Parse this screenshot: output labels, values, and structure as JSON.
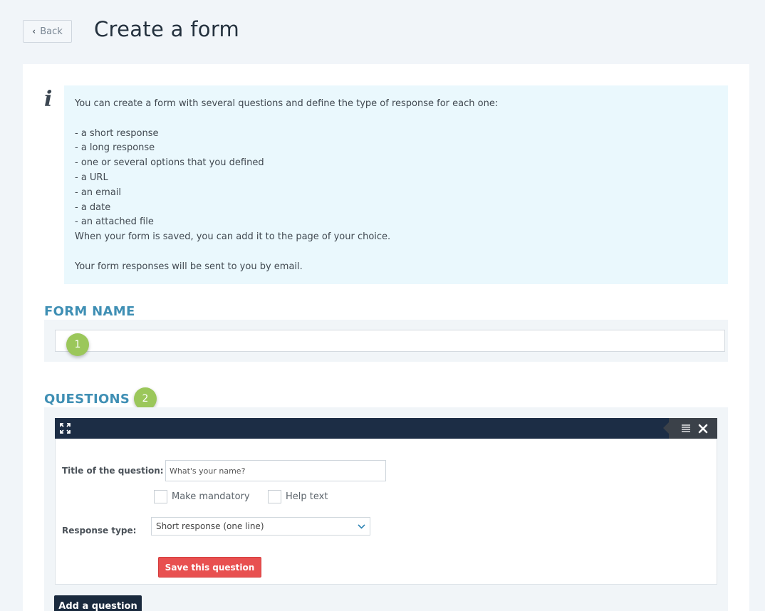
{
  "header": {
    "back_label": "Back",
    "title": "Create a form"
  },
  "info": {
    "text": "You can create a form with several questions and define the type of response for each one:\n\n- a short response\n- a long response\n- one or several options that you defined\n- a URL\n- an email\n- a date\n- an attached file\nWhen your form is saved, you can add it to the page of your choice.\n\nYour form responses will be sent to you by email."
  },
  "form_name": {
    "heading": "FORM NAME",
    "value": "",
    "step": "1"
  },
  "questions": {
    "heading": "QUESTIONS",
    "step": "2",
    "title_label": "Title of the question:",
    "title_placeholder": "What's your name?",
    "mandatory_label": "Make mandatory",
    "help_label": "Help text",
    "response_type_label": "Response type:",
    "response_type_value": "Short response (one line)",
    "save_label": "Save this question",
    "add_label": "Add a question"
  },
  "colors": {
    "accent": "#3f8fb4",
    "badge": "#9bc75a",
    "save": "#e85050",
    "toolbar": "#1c2d45"
  }
}
